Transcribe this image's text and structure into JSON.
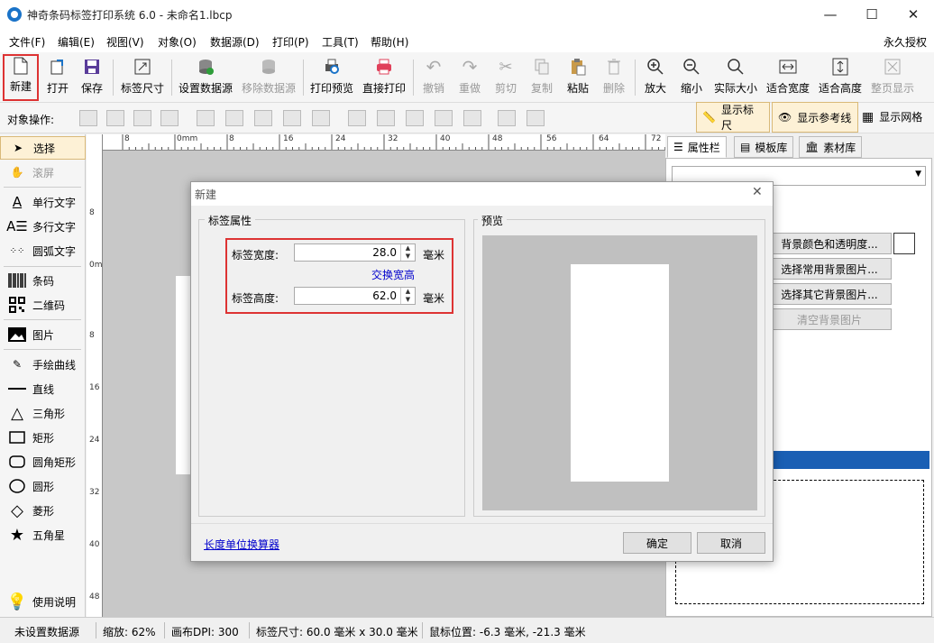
{
  "window": {
    "title": "神奇条码标签打印系统 6.0 - 未命名1.lbcp"
  },
  "menu": {
    "items": [
      "文件(F)",
      "编辑(E)",
      "视图(V)",
      "对象(O)",
      "数据源(D)",
      "打印(P)",
      "工具(T)",
      "帮助(H)"
    ],
    "license": "永久授权"
  },
  "toolbar": {
    "buttons": [
      {
        "label": "新建",
        "icon": "new-file-icon"
      },
      {
        "label": "打开",
        "icon": "open-icon"
      },
      {
        "label": "保存",
        "icon": "save-icon"
      },
      {
        "label": "标签尺寸",
        "icon": "label-size-icon"
      },
      {
        "label": "设置数据源",
        "icon": "database-icon"
      },
      {
        "label": "移除数据源",
        "icon": "remove-database-icon"
      },
      {
        "label": "打印预览",
        "icon": "print-preview-icon"
      },
      {
        "label": "直接打印",
        "icon": "printer-icon"
      },
      {
        "label": "撤销",
        "icon": "undo-icon"
      },
      {
        "label": "重做",
        "icon": "redo-icon"
      },
      {
        "label": "剪切",
        "icon": "cut-icon"
      },
      {
        "label": "复制",
        "icon": "copy-icon"
      },
      {
        "label": "粘贴",
        "icon": "paste-icon"
      },
      {
        "label": "删除",
        "icon": "delete-icon"
      },
      {
        "label": "放大",
        "icon": "zoom-in-icon"
      },
      {
        "label": "缩小",
        "icon": "zoom-out-icon"
      },
      {
        "label": "实际大小",
        "icon": "actual-size-icon"
      },
      {
        "label": "适合宽度",
        "icon": "fit-width-icon"
      },
      {
        "label": "适合高度",
        "icon": "fit-height-icon"
      },
      {
        "label": "整页显示",
        "icon": "full-page-icon"
      }
    ]
  },
  "object_toolbar": {
    "label": "对象操作:",
    "show_ruler": "显示标尺",
    "show_guides": "显示参考线",
    "show_grid": "显示网格"
  },
  "left_panel": {
    "items": [
      "选择",
      "滚屏",
      "单行文字",
      "多行文字",
      "圆弧文字",
      "条码",
      "二维码",
      "图片",
      "手绘曲线",
      "直线",
      "三角形",
      "矩形",
      "圆角矩形",
      "圆形",
      "菱形",
      "五角星"
    ],
    "help": "使用说明"
  },
  "ruler": {
    "top_labels": [
      "8",
      "0mm",
      "8",
      "16",
      "24",
      "32",
      "40",
      "48",
      "56",
      "64",
      "72"
    ],
    "left_labels": [
      "8",
      "0mm",
      "8",
      "16",
      "24",
      "32",
      "40",
      "48"
    ]
  },
  "right_panel": {
    "tabs": [
      "属性栏",
      "模板库",
      "素材库"
    ],
    "buttons": [
      "背景颜色和透明度...",
      "选择常用背景图片...",
      "选择其它背景图片...",
      "清空背景图片"
    ]
  },
  "dialog": {
    "title": "新建",
    "group_label": "标签属性",
    "preview_label": "预览",
    "width_label": "标签宽度:",
    "width_value": "28.0",
    "height_label": "标签高度:",
    "height_value": "62.0",
    "unit": "毫米",
    "swap_link": "交换宽高",
    "converter_link": "长度单位换算器",
    "ok": "确定",
    "cancel": "取消"
  },
  "status": {
    "datasource": "未设置数据源",
    "zoom": "缩放: 62%",
    "dpi": "画布DPI: 300",
    "label_size": "标签尺寸: 60.0 毫米 x 30.0 毫米",
    "mouse_pos": "鼠标位置: -6.3 毫米, -21.3 毫米"
  },
  "colors": {
    "accent_red": "#d33333",
    "link_blue": "#0000cc",
    "selection_blue": "#1a5fb4"
  }
}
